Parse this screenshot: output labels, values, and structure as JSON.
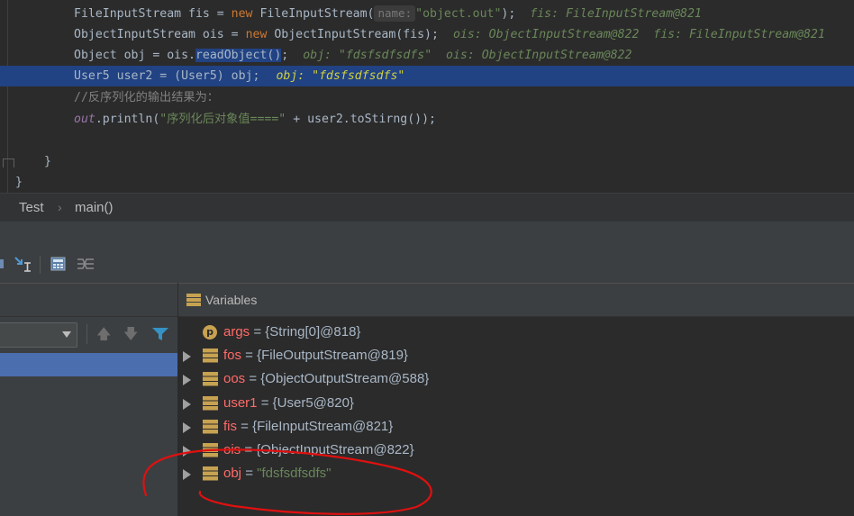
{
  "editor": {
    "lines": [
      {
        "id": "fis",
        "parts": [
          {
            "t": "FileInputStream fis = ",
            "c": "txt"
          },
          {
            "t": "new",
            "c": "kw"
          },
          {
            "t": " FileInputStream(",
            "c": "txt"
          },
          {
            "t": "name:",
            "c": "hint"
          },
          {
            "t": "\"object.out\"",
            "c": "str"
          },
          {
            "t": ");",
            "c": "txt"
          },
          {
            "t": "fis: FileInputStream@821",
            "c": "inline"
          }
        ]
      },
      {
        "id": "ois",
        "parts": [
          {
            "t": "ObjectInputStream ois = ",
            "c": "txt"
          },
          {
            "t": "new",
            "c": "kw"
          },
          {
            "t": " ObjectInputStream(fis);",
            "c": "txt"
          },
          {
            "t": "ois: ObjectInputStream@822  fis: FileInputStream@821",
            "c": "inline"
          }
        ]
      },
      {
        "id": "obj",
        "parts": [
          {
            "t": "Object obj = ois.",
            "c": "txt"
          },
          {
            "t": "readObject()",
            "c": "selword"
          },
          {
            "t": ";",
            "c": "txt"
          },
          {
            "t": "obj: \"fdsfsdfsdfs\"  ois: ObjectInputStream@822",
            "c": "inline"
          }
        ]
      },
      {
        "id": "user2",
        "parts": [
          {
            "t": "User5 user2 = (User5) obj;",
            "c": "txt"
          },
          {
            "t": "obj: \"fdsfsdfsdfs\"",
            "c": "inlinesel"
          }
        ]
      },
      {
        "id": "comment",
        "parts": [
          {
            "t": "//反序列化的输出结果为：",
            "c": "cmt"
          }
        ]
      },
      {
        "id": "println",
        "parts": [
          {
            "t": "out",
            "c": "fld"
          },
          {
            "t": ".println(",
            "c": "txt"
          },
          {
            "t": "\"序列化后对象值====\"",
            "c": "str"
          },
          {
            "t": " + user2.toStirng());",
            "c": "txt"
          }
        ]
      },
      {
        "id": "blank",
        "parts": []
      },
      {
        "id": "close1",
        "parts": [
          {
            "t": "}",
            "c": "txt"
          }
        ]
      },
      {
        "id": "close2",
        "parts": [
          {
            "t": "}",
            "c": "txt"
          }
        ]
      }
    ]
  },
  "breadcrumb": {
    "class_name": "Test",
    "separator": "›",
    "method_name": "main()"
  },
  "debugger": {
    "variables_title": "Variables",
    "frames_nav": {
      "up": "🡅",
      "down": "🡇"
    },
    "variables": [
      {
        "kind": "param",
        "badge": "p",
        "name": "args",
        "eq": " = ",
        "value": "{String[0]@818}",
        "expandable": false
      },
      {
        "kind": "field",
        "name": "fos",
        "eq": " = ",
        "value": "{FileOutputStream@819}",
        "expandable": true
      },
      {
        "kind": "field",
        "name": "oos",
        "eq": " = ",
        "value": "{ObjectOutputStream@588}",
        "expandable": true
      },
      {
        "kind": "field",
        "name": "user1",
        "eq": " = ",
        "value": "{User5@820}",
        "expandable": true
      },
      {
        "kind": "field",
        "name": "fis",
        "eq": " = ",
        "value": "{FileInputStream@821}",
        "expandable": true
      },
      {
        "kind": "field",
        "name": "ois",
        "eq": " = ",
        "value": "{ObjectInputStream@822}",
        "expandable": true
      },
      {
        "kind": "field",
        "name": "obj",
        "eq": " = ",
        "value": "\"fdsfsdfsdfs\"",
        "expandable": true,
        "string": true
      }
    ]
  },
  "colors": {
    "editor_bg": "#2b2b2b",
    "highlight_line": "#214283",
    "selected_frame": "#4b6eaf",
    "variable_name": "#ff6b68",
    "string_value": "#6a8759",
    "annotation_red": "#e01010"
  }
}
